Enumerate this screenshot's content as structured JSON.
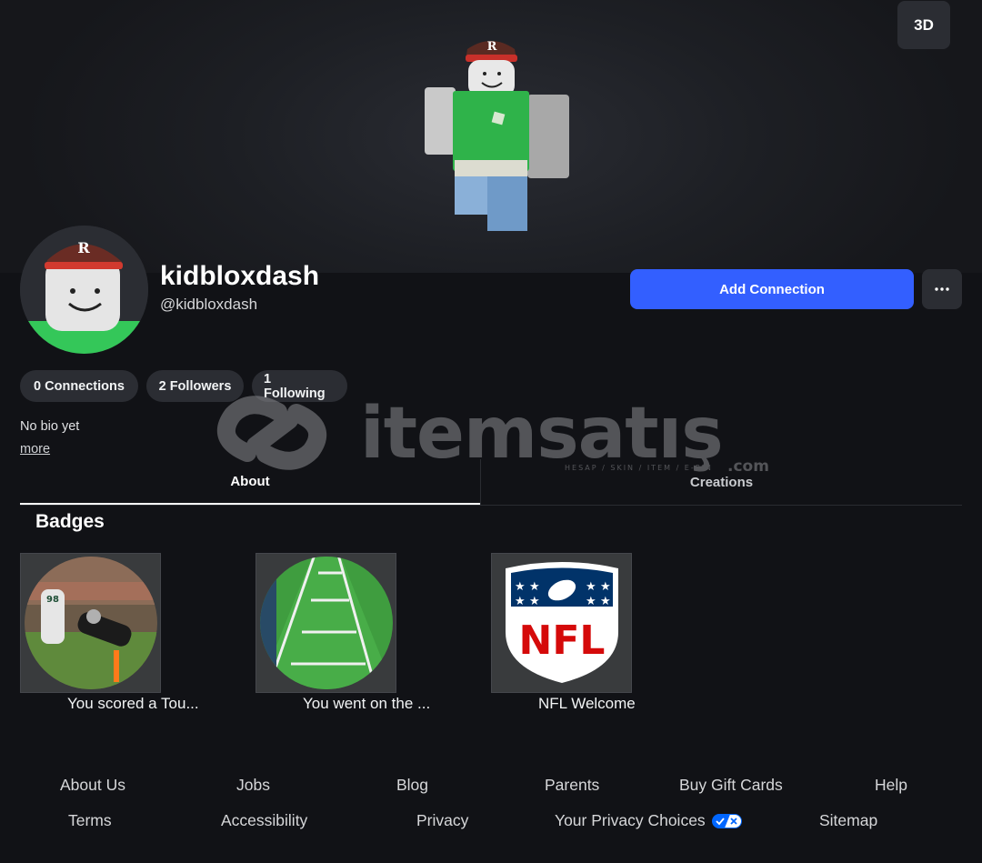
{
  "hero": {
    "view_mode_label": "3D"
  },
  "profile": {
    "display_name": "kidbloxdash",
    "username": "@kidbloxdash",
    "add_connection_label": "Add Connection",
    "more_options_icon": "ellipsis-icon"
  },
  "stats": {
    "connections": "0 Connections",
    "followers": "2 Followers",
    "following": "1 Following"
  },
  "bio": {
    "text": "No bio yet",
    "more_label": "more"
  },
  "tabs": {
    "about": "About",
    "creations": "Creations"
  },
  "badges": {
    "title": "Badges",
    "items": [
      {
        "name": "You scored a Tou..."
      },
      {
        "name": "You went on the ..."
      },
      {
        "name": "NFL Welcome"
      }
    ]
  },
  "footer": {
    "row1": [
      "About Us",
      "Jobs",
      "Blog",
      "Parents",
      "Buy Gift Cards",
      "Help"
    ],
    "row2": [
      "Terms",
      "Accessibility",
      "Privacy",
      "Your Privacy Choices",
      "Sitemap"
    ]
  },
  "watermark": {
    "brand": "itemsatış",
    "tagline": "HESAP / SKIN / ITEM / E-PIN",
    "tld": ".com"
  },
  "colors": {
    "accent": "#335fff",
    "background": "#111216",
    "surface": "#2b2d33",
    "avatar_green": "#34c759"
  }
}
